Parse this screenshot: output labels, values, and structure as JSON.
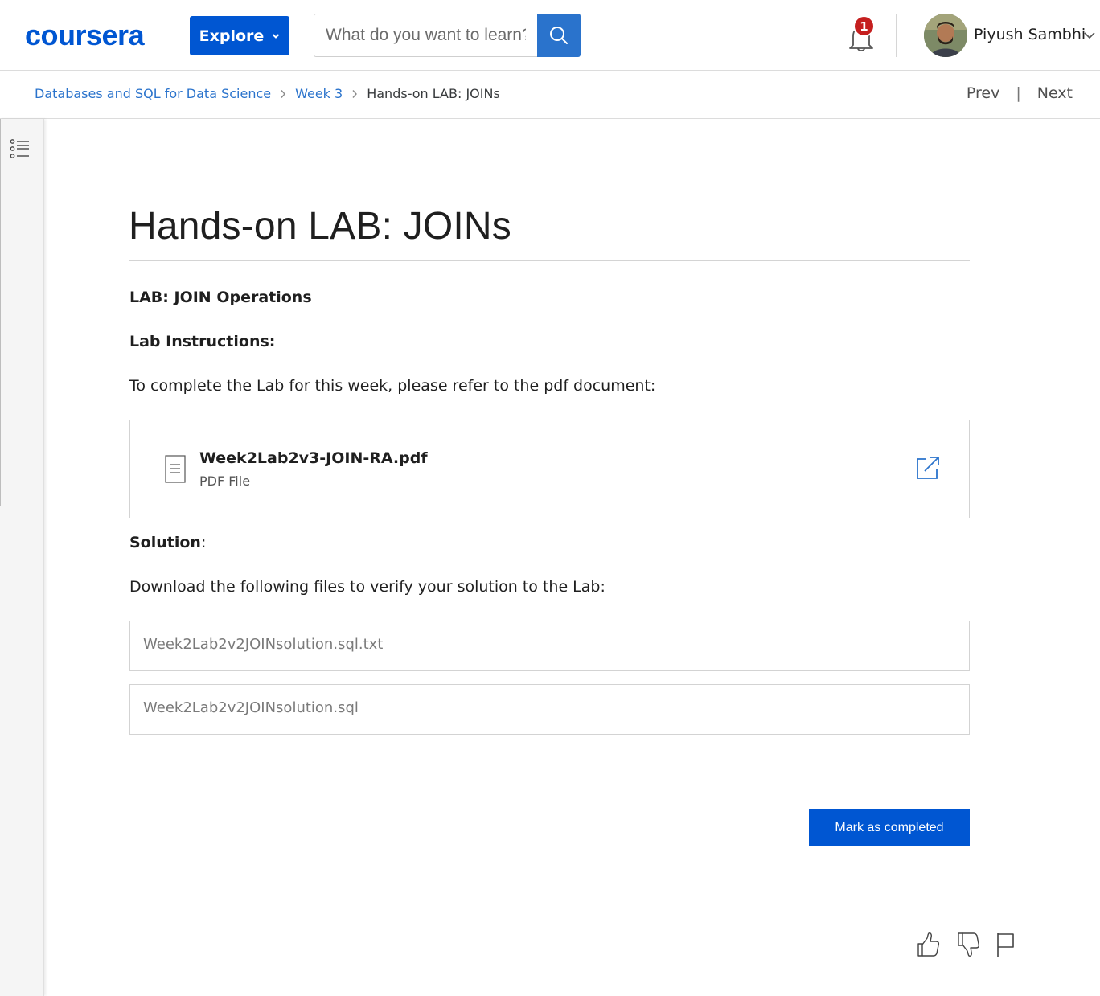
{
  "header": {
    "logo_text": "coursera",
    "explore_label": "Explore",
    "search_placeholder": "What do you want to learn?",
    "notification_count": "1",
    "user_name": "Piyush Sambhi",
    "brand_color": "#0056d2",
    "icons": [
      "search-icon",
      "bell-icon",
      "chevron-down-icon",
      "avatar"
    ]
  },
  "breadcrumb": {
    "items": [
      "Databases and SQL for Data Science",
      "Week 3"
    ],
    "current": "Hands-on LAB: JOINs",
    "prev_label": "Prev",
    "divider": "|",
    "next_label": "Next"
  },
  "content": {
    "title": "Hands-on LAB: JOINs",
    "lab_heading": "LAB: JOIN Operations",
    "instructions_heading": "Lab Instructions:",
    "instructions_text": "To complete the Lab for this week, please refer to the pdf document:",
    "pdf": {
      "name": "Week2Lab2v3-JOIN-RA.pdf",
      "type": "PDF File"
    },
    "solution_heading": "Solution",
    "solution_colon": ":",
    "download_text": "Download the following files to verify your solution to the Lab:",
    "downloads": [
      "Week2Lab2v2JOINsolution.sql.txt",
      "Week2Lab2v2JOINsolution.sql"
    ],
    "mark_completed_label": "Mark as completed"
  },
  "feedback": {
    "icons": [
      "thumbs-up-icon",
      "thumbs-down-icon",
      "flag-icon"
    ]
  }
}
